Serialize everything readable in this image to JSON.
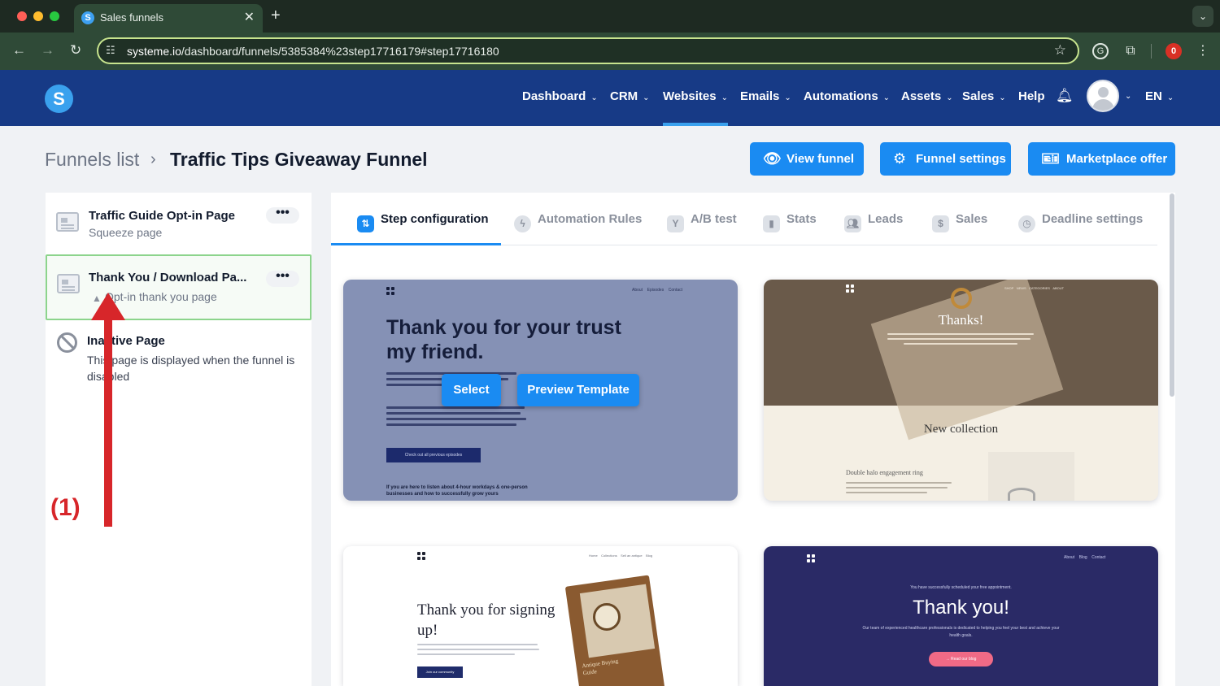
{
  "browser": {
    "tab_title": "Sales funnels",
    "tab_favicon_letter": "S",
    "url_host": "systeme.io",
    "url_path": "/dashboard/funnels/5385384%23step17716179#step17716180",
    "extension_badge": "0",
    "extension_g": "G",
    "icons": [
      "back-icon",
      "forward-icon",
      "reload-icon",
      "site-info-icon",
      "star-icon",
      "extensions-icon",
      "menu-dots-icon"
    ]
  },
  "header": {
    "logo_letter": "S",
    "nav": [
      {
        "label": "Dashboard",
        "has_menu": true
      },
      {
        "label": "CRM",
        "has_menu": true
      },
      {
        "label": "Websites",
        "has_menu": true,
        "active": true
      },
      {
        "label": "Emails",
        "has_menu": true
      },
      {
        "label": "Automations",
        "has_menu": true
      },
      {
        "label": "Assets",
        "has_menu": true
      },
      {
        "label": "Sales",
        "has_menu": true
      },
      {
        "label": "Help",
        "has_menu": false
      }
    ],
    "language": "EN"
  },
  "breadcrumb": {
    "parent": "Funnels list",
    "current": "Traffic Tips Giveaway Funnel"
  },
  "actions": {
    "view_funnel": "View funnel",
    "funnel_settings": "Funnel settings",
    "marketplace_offer": "Marketplace offer"
  },
  "steps": [
    {
      "name": "Traffic Guide Opt-in Page",
      "type": "Squeeze page",
      "more": "•••"
    },
    {
      "name": "Thank You / Download Pa...",
      "type": "Opt-in thank you page",
      "more": "•••",
      "selected": true
    }
  ],
  "inactive_page": {
    "title": "Inactive Page",
    "description": "This page is displayed when the funnel is disabled"
  },
  "config_tabs": [
    {
      "label": "Step configuration",
      "active": true
    },
    {
      "label": "Automation Rules"
    },
    {
      "label": "A/B test"
    },
    {
      "label": "Stats"
    },
    {
      "label": "Leads"
    },
    {
      "label": "Sales"
    },
    {
      "label": "Deadline settings"
    }
  ],
  "templates": {
    "card1": {
      "nav": [
        "About",
        "Episodes",
        "Contact"
      ],
      "title": "Thank you for your trust my friend.",
      "button": "Check out all previous episodes",
      "footer": "If you are here to listen about 4-hour workdays & one-person businesses and how to successfully grow yours",
      "select_label": "Select",
      "preview_label": "Preview Template"
    },
    "card2": {
      "nav": [
        "SHOP",
        "NEWS",
        "CATEGORIES",
        "ABOUT"
      ],
      "thanks": "Thanks!",
      "collection": "New collection",
      "product": "Double halo engagement ring"
    },
    "card3": {
      "nav": [
        "Home",
        "Collections",
        "Sell an antique",
        "Blog"
      ],
      "title": "Thank you for signing up!",
      "button": "Join our community",
      "book_title": "Antique Buying Guide"
    },
    "card4": {
      "nav": [
        "About",
        "Blog",
        "Contact"
      ],
      "kicker": "You have successfully scheduled your free appointment.",
      "title": "Thank you!",
      "body": "Our team of experienced healthcare professionals is dedicated to helping you feel your best and achieve your health goals.",
      "button": "→ Read our blog"
    }
  },
  "annotation": {
    "label": "(1)",
    "color": "#d7262a"
  },
  "colors": {
    "brand_navy": "#173a86",
    "brand_blue": "#1a8bf2",
    "selected_border": "#8cd48c"
  }
}
